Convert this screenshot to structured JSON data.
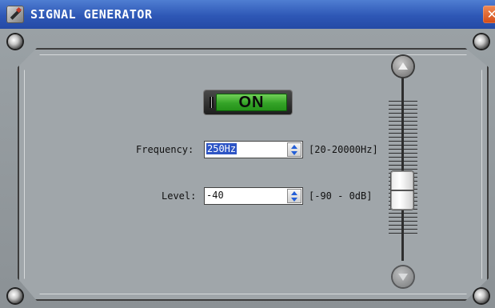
{
  "window": {
    "title": "SIGNAL GENERATOR",
    "close_glyph": "✕",
    "app_icon": "signal-generator-icon"
  },
  "power": {
    "label": "ON",
    "state": "on",
    "color": "#34a327"
  },
  "frequency": {
    "label": "Frequency:",
    "value": "250Hz",
    "range": "[20-20000Hz]"
  },
  "level": {
    "label": "Level:",
    "value": "-40",
    "range": "[-90 - 0dB]"
  },
  "slider": {
    "up_icon": "arrow-up-icon",
    "down_icon": "arrow-down-icon",
    "value_db": -40,
    "min_db": -90,
    "max_db": 0
  },
  "colors": {
    "titlebar": "#2e57b6",
    "close": "#d34b16",
    "panel": "#a0a6aa"
  }
}
